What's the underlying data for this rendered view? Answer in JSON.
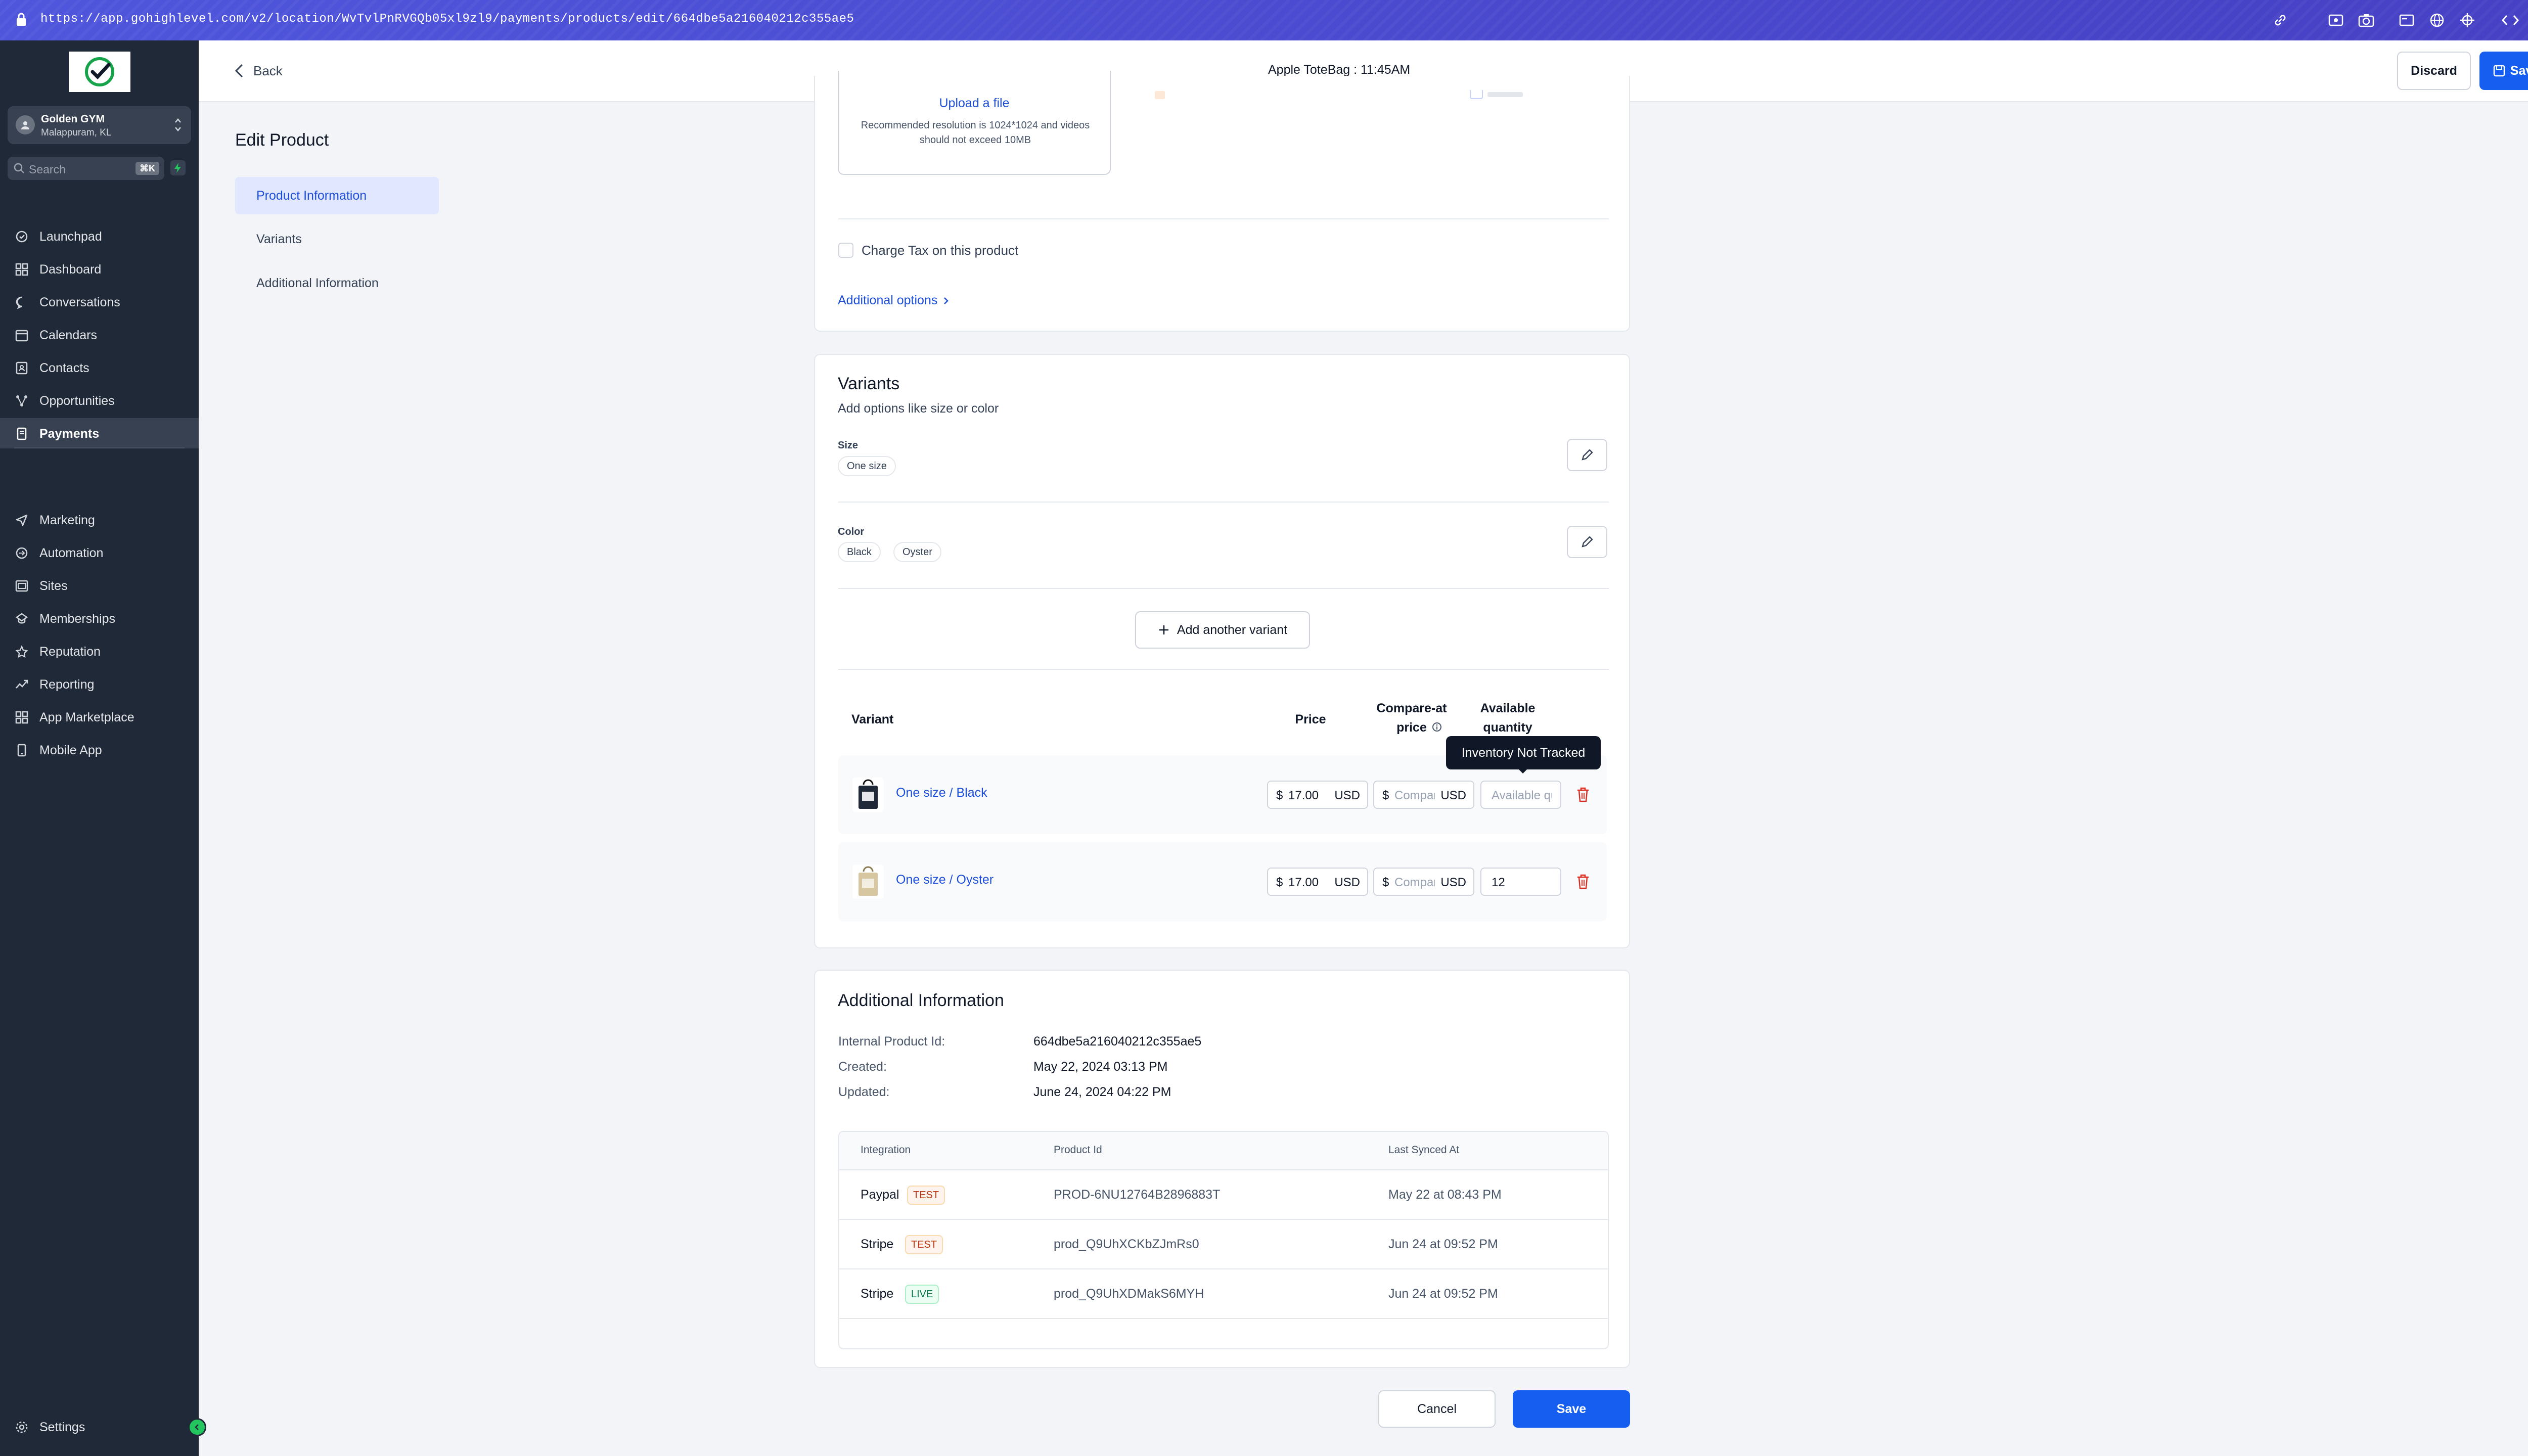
{
  "browser": {
    "url": "https://app.gohighlevel.com/v2/location/WvTvlPnRVGQb05xl9zl9/payments/products/edit/664dbe5a216040212c355ae5"
  },
  "sidebar": {
    "account": {
      "name": "Golden GYM",
      "location": "Malappuram, KL"
    },
    "search": {
      "placeholder": "Search",
      "shortcut": "⌘K"
    },
    "items": [
      {
        "label": "Launchpad",
        "icon": "launchpad-icon"
      },
      {
        "label": "Dashboard",
        "icon": "dashboard-icon"
      },
      {
        "label": "Conversations",
        "icon": "chat-icon"
      },
      {
        "label": "Calendars",
        "icon": "calendar-icon"
      },
      {
        "label": "Contacts",
        "icon": "contacts-icon"
      },
      {
        "label": "Opportunities",
        "icon": "opportunities-icon"
      },
      {
        "label": "Payments",
        "icon": "payments-icon",
        "active": true
      },
      {
        "label": "Marketing",
        "icon": "send-icon"
      },
      {
        "label": "Automation",
        "icon": "automation-icon"
      },
      {
        "label": "Sites",
        "icon": "sites-icon"
      },
      {
        "label": "Memberships",
        "icon": "memberships-icon"
      },
      {
        "label": "Reputation",
        "icon": "reputation-icon"
      },
      {
        "label": "Reporting",
        "icon": "reporting-icon"
      },
      {
        "label": "App Marketplace",
        "icon": "marketplace-icon"
      },
      {
        "label": "Mobile App",
        "icon": "mobile-icon"
      }
    ],
    "settings": "Settings"
  },
  "header": {
    "back": "Back",
    "title": "Apple ToteBag : 11:45AM",
    "discard": "Discard",
    "save": "Save"
  },
  "page": {
    "title": "Edit Product",
    "subnav": [
      "Product Information",
      "Variants",
      "Additional Information"
    ]
  },
  "media": {
    "upload_link": "Upload a file",
    "hint": "Recommended resolution is 1024*1024 and videos should not exceed 10MB"
  },
  "tax": {
    "label": "Charge Tax on this product",
    "checked": false
  },
  "additional_options": "Additional options",
  "variants": {
    "title": "Variants",
    "subtitle": "Add options like size or color",
    "options": [
      {
        "name": "Size",
        "values": [
          "One size"
        ]
      },
      {
        "name": "Color",
        "values": [
          "Black",
          "Oyster"
        ]
      }
    ],
    "add_button": "Add another variant",
    "columns": {
      "variant": "Variant",
      "price": "Price",
      "compare": "Compare-at price",
      "quantity": "Available quantity"
    },
    "rows": [
      {
        "name": "One size / Black",
        "currency_symbol": "$",
        "price": "17.00",
        "currency": "USD",
        "compare_placeholder": "Compare-at price",
        "quantity": "",
        "quantity_placeholder": "Available quantity",
        "swatch": "#1f2937"
      },
      {
        "name": "One size / Oyster",
        "currency_symbol": "$",
        "price": "17.00",
        "currency": "USD",
        "compare_placeholder": "Compare-at price",
        "quantity": "12",
        "quantity_placeholder": "",
        "swatch": "#d6c7a1"
      }
    ],
    "tooltip": "Inventory Not Tracked"
  },
  "additional_info": {
    "title": "Additional Information",
    "fields": [
      {
        "label": "Internal Product Id:",
        "value": "664dbe5a216040212c355ae5"
      },
      {
        "label": "Created:",
        "value": "May 22, 2024 03:13 PM"
      },
      {
        "label": "Updated:",
        "value": "June 24, 2024 04:22 PM"
      }
    ],
    "table": {
      "headers": [
        "Integration",
        "Product Id",
        "Last Synced At"
      ],
      "rows": [
        {
          "integration": "Paypal",
          "badge": "TEST",
          "product_id": "PROD-6NU12764B2896883T",
          "synced": "May 22 at 08:43 PM"
        },
        {
          "integration": "Stripe",
          "badge": "TEST",
          "product_id": "prod_Q9UhXCKbZJmRs0",
          "synced": "Jun 24 at 09:52 PM"
        },
        {
          "integration": "Stripe",
          "badge": "LIVE",
          "product_id": "prod_Q9UhXDMakS6MYH",
          "synced": "Jun 24 at 09:52 PM"
        }
      ]
    }
  },
  "footer": {
    "cancel": "Cancel",
    "save": "Save"
  },
  "colors": {
    "primary": "#155eef",
    "sidebar": "#1f2937",
    "link": "#1d4ed8"
  }
}
